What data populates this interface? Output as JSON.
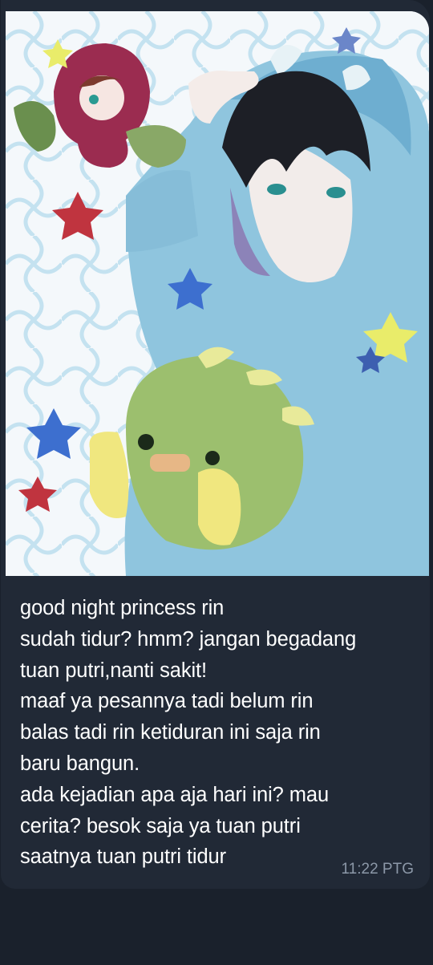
{
  "message": {
    "text": "good night princess rin\nsudah tidur? hmm? jangan begadang\ntuan putri,nanti sakit!\nmaaf ya pesannya tadi belum rin\nbalas tadi rin ketiduran ini saja rin\nbaru bangun.\nada kejadian apa aja hari ini? mau\ncerita? besok saja ya tuan putri\nsaatnya tuan putri tidur",
    "time": "11:22 PTG",
    "photo_icon": "anime-illustration-image"
  },
  "colors": {
    "chat_background": "#1a212c",
    "bubble": "#212936",
    "text": "#ffffff",
    "time": "#8c98a8"
  }
}
